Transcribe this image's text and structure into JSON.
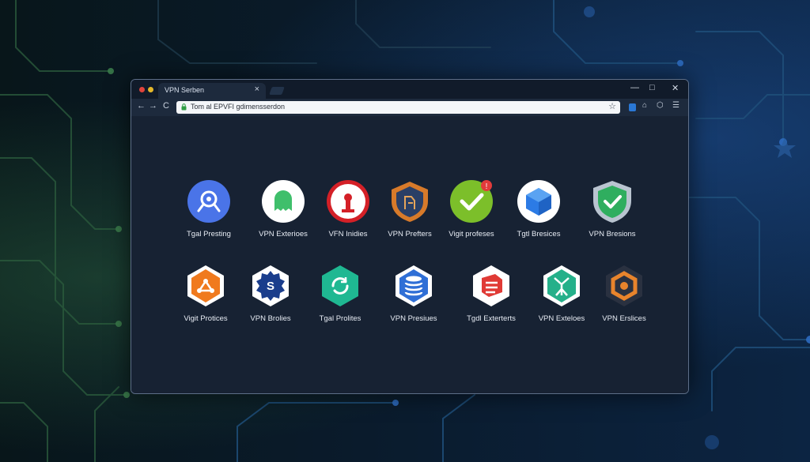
{
  "browser": {
    "tab_title": "VPN Serben",
    "tab_close": "×",
    "url": "Tom al EPVFI gdimensserdon",
    "window_controls": {
      "minimize": "—",
      "maximize": "□",
      "close": "✕"
    },
    "nav": {
      "back": "←",
      "forward": "→",
      "reload": "C"
    },
    "bookmark": "☆",
    "menu": "☰"
  },
  "apps": [
    {
      "label": "Tgal Presting",
      "icon": "search-icon",
      "color": "#4a74e8"
    },
    {
      "label": "VPN Exterioes",
      "icon": "ghost-icon",
      "color": "#3fbf6b"
    },
    {
      "label": "VFN Inidies",
      "icon": "chess-pawn-icon",
      "color": "#d42027"
    },
    {
      "label": "VPN Prefters",
      "icon": "crest-icon",
      "color": "#d77a2a"
    },
    {
      "label": "Vigit profeses",
      "icon": "checkmark-icon",
      "color": "#7cbf2a",
      "badge": "!"
    },
    {
      "label": "Tgtl Bresices",
      "icon": "cube-icon",
      "color": "#2c7be5"
    },
    {
      "label": "VPN Bresions",
      "icon": "shield-check-icon",
      "color": "#2fae5f"
    },
    {
      "label": "Vigit Protices",
      "icon": "network-icon",
      "color": "#f07a1e"
    },
    {
      "label": "VPN Brolies",
      "icon": "s-badge-icon",
      "color": "#1a3d8c"
    },
    {
      "label": "Tgal Prolites",
      "icon": "refresh-icon",
      "color": "#1fb892"
    },
    {
      "label": "VPN Presiues",
      "icon": "database-icon",
      "color": "#2f6fd6"
    },
    {
      "label": "Tgdl Exterterts",
      "icon": "layers-icon",
      "color": "#e03a35"
    },
    {
      "label": "VPN Exteloes",
      "icon": "tree-icon",
      "color": "#25b08a"
    },
    {
      "label": "VPN Erslices",
      "icon": "hexagon-icon",
      "color": "#e8842c"
    }
  ]
}
